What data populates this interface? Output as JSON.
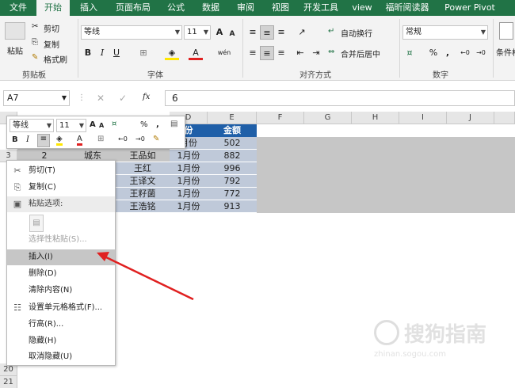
{
  "ribbon_tabs": [
    "文件",
    "开始",
    "插入",
    "页面布局",
    "公式",
    "数据",
    "审阅",
    "视图",
    "开发工具",
    "view",
    "福昕阅读器",
    "Power Pivot"
  ],
  "active_tab": "开始",
  "clipboard": {
    "paste": "粘贴",
    "cut": "剪切",
    "copy": "复制",
    "format_painter": "格式刷",
    "group": "剪贴板"
  },
  "font": {
    "name": "等线",
    "size": "11",
    "bold": "B",
    "italic": "I",
    "underline": "U",
    "grow": "A",
    "shrink": "A",
    "phonetic": "wén",
    "group": "字体"
  },
  "alignment": {
    "wrap": "自动换行",
    "merge": "合并后居中",
    "group": "对齐方式"
  },
  "number": {
    "format": "常规",
    "percent": "%",
    "comma": ",",
    "group": "数字"
  },
  "styles": {
    "conditional": "条件格"
  },
  "name_box": "A7",
  "formula_value": "6",
  "fx_label": "fx",
  "columns": [
    "D",
    "E",
    "F",
    "G",
    "H",
    "I",
    "J"
  ],
  "row_numbers": [
    "3",
    "20",
    "21"
  ],
  "header_row": {
    "d": "份",
    "e": "金额"
  },
  "rows": [
    {
      "a": "",
      "b": "",
      "c": "",
      "d": "月份",
      "e": "502"
    },
    {
      "a": "2",
      "b": "城东",
      "c": "王品如",
      "d": "1月份",
      "e": "882"
    },
    {
      "a": "",
      "b": "",
      "c": "王红",
      "d": "1月份",
      "e": "996"
    },
    {
      "a": "",
      "b": "",
      "c": "王译文",
      "d": "1月份",
      "e": "792"
    },
    {
      "a": "",
      "b": "",
      "c": "王籽菌",
      "d": "1月份",
      "e": "772"
    },
    {
      "a": "",
      "b": "",
      "c": "王浩铭",
      "d": "1月份",
      "e": "913"
    }
  ],
  "mini_toolbar": {
    "font": "等线",
    "size": "11",
    "bold": "B",
    "italic": "I",
    "percent": "%",
    "comma": ","
  },
  "context_menu": [
    {
      "label": "剪切(T)",
      "icon": "cut-icon",
      "state": "normal"
    },
    {
      "label": "复制(C)",
      "icon": "copy-icon",
      "state": "normal"
    },
    {
      "label": "粘贴选项:",
      "icon": "paste-icon",
      "state": "section"
    },
    {
      "label": "选择性粘贴(S)...",
      "icon": "",
      "state": "disabled"
    },
    {
      "label": "插入(I)",
      "icon": "",
      "state": "highlight"
    },
    {
      "label": "删除(D)",
      "icon": "",
      "state": "normal"
    },
    {
      "label": "清除内容(N)",
      "icon": "",
      "state": "normal"
    },
    {
      "label": "设置单元格格式(F)...",
      "icon": "format-cells-icon",
      "state": "normal"
    },
    {
      "label": "行高(R)...",
      "icon": "",
      "state": "normal"
    },
    {
      "label": "隐藏(H)",
      "icon": "",
      "state": "normal"
    },
    {
      "label": "取消隐藏(U)",
      "icon": "",
      "state": "normal"
    }
  ],
  "watermark": {
    "text": "搜狗指南",
    "sub": "zhinan.sogou.com"
  },
  "colors": {
    "ribbon_green": "#217346",
    "header_blue": "#1f5fa8",
    "data_fill": "#bfc9d9",
    "selection_gray": "#c6c6c6",
    "arrow_red": "#e02020"
  }
}
